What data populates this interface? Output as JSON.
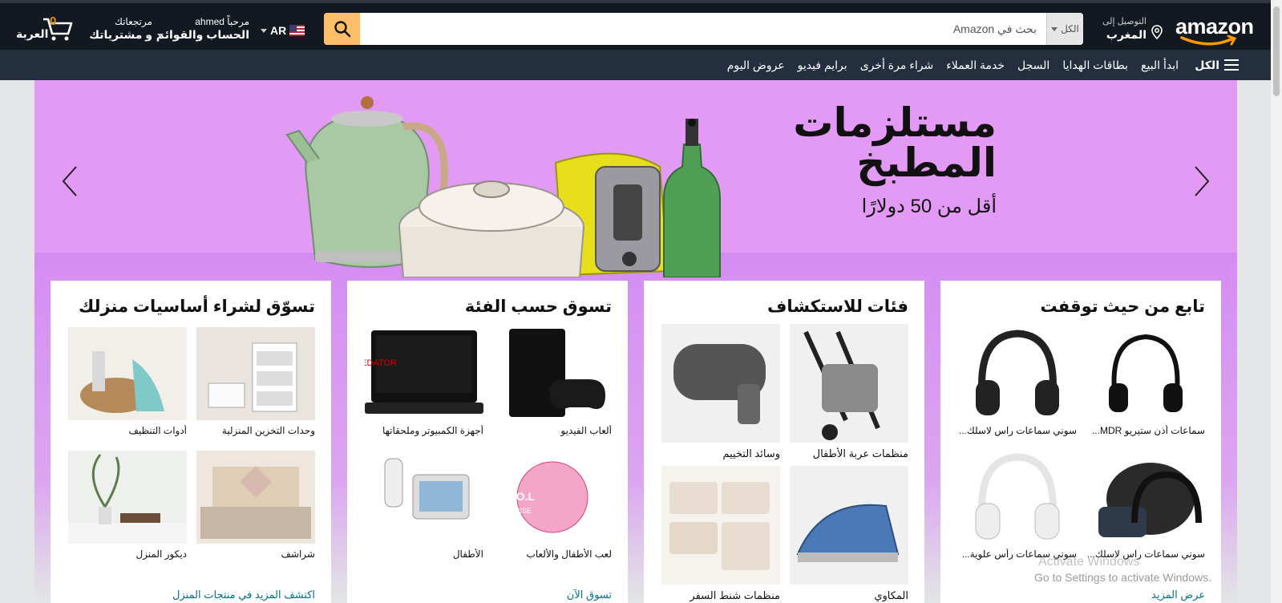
{
  "header": {
    "logo_text": "amazon",
    "deliver_line1": "التوصيل إلى",
    "deliver_line2": "المغرب",
    "search_category": "الكل",
    "search_placeholder": "بحث في Amazon",
    "language": "AR",
    "account_line1": "مرحباً ahmed",
    "account_line2": "الحساب والقوائم",
    "returns_line1": "مرتجعاتك",
    "returns_line2": "و مشترياتك",
    "cart_count": "0",
    "cart_label": "العربة"
  },
  "nav": {
    "all_label": "الكل",
    "items": [
      "عروض اليوم",
      "برايم فيديو",
      "شراء مرة أخرى",
      "خدمة العملاء",
      "السجل",
      "بطاقات الهدايا",
      "ابدأ البيع"
    ]
  },
  "hero": {
    "title_line1": "مستلزمات",
    "title_line2": "المطبخ",
    "subtitle": "أقل من 50 دولارًا"
  },
  "cards": [
    {
      "title": "تابع من حيث توقفت",
      "tiles": [
        {
          "caption": "سماعات أذن ستيريو MDR..."
        },
        {
          "caption": "سوني سماعات راس لاسلك..."
        },
        {
          "caption": "سوني سماعات راس لاسلك..."
        },
        {
          "caption": "سوني سماعات رأس علوية..."
        }
      ],
      "more": "عرض المزيد"
    },
    {
      "title": "فئات للاستكشاف",
      "tiles": [
        {
          "caption": "منظمات عربة الأطفال"
        },
        {
          "caption": "وسائد التخييم"
        },
        {
          "caption": "المكاوي"
        },
        {
          "caption": "منظمات شنط السفر"
        }
      ],
      "more": ""
    },
    {
      "title": "تسوق حسب الفئة",
      "tiles": [
        {
          "caption": "ألعاب الفيديو"
        },
        {
          "caption": "أجهزة الكمبيوتر وملحقاتها"
        },
        {
          "caption": "لعب الأطفال والألعاب"
        },
        {
          "caption": "الأطفال"
        }
      ],
      "more": "تسوق الآن"
    },
    {
      "title": "تسوّق لشراء أساسيات منزلك",
      "tiles": [
        {
          "caption": "وحدات التخزين المنزلية"
        },
        {
          "caption": "أدوات التنظيف"
        },
        {
          "caption": "شراشف"
        },
        {
          "caption": "ديكور المنزل"
        }
      ],
      "more": "اكتشف المزيد في منتجات المنزل"
    }
  ],
  "tile_texts": {
    "predator": "PREDATOR",
    "lol": "L.O.L.",
    "lol_sub": "SURPRISE"
  },
  "overlay": {
    "activate_title": "Activate Windows",
    "activate_sub": "Go to Settings to activate Windows."
  },
  "colors": {
    "topbar": "#131921",
    "navbar": "#232f3e",
    "search_button": "#febd69",
    "hero_bg": "#e29af5",
    "link": "#007185",
    "cart_count": "#f08804"
  }
}
